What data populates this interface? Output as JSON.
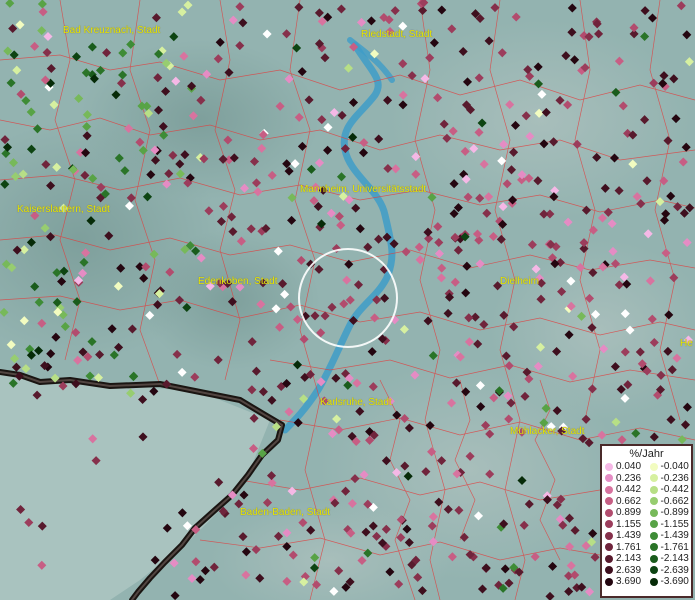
{
  "map": {
    "cities": [
      {
        "id": "bad-kreuznach",
        "label": "Bad Kreuznach, Stadt"
      },
      {
        "id": "riedstadt",
        "label": "Riedstadt, Stadt"
      },
      {
        "id": "mannheim",
        "label": "Mannheim, Universitätsstadt"
      },
      {
        "id": "kaiserslautern",
        "label": "Kaiserslautern, Stadt"
      },
      {
        "id": "edenkoben",
        "label": "Edenkoben, Stadt"
      },
      {
        "id": "dielheim",
        "label": "Dielheim"
      },
      {
        "id": "he-partial",
        "label": "He"
      },
      {
        "id": "karlsruhe",
        "label": "Karlsruhe, Stadt"
      },
      {
        "id": "muehlacker",
        "label": "Mühlacker, Stadt"
      },
      {
        "id": "baden-baden",
        "label": "Baden-Baden, Stadt"
      }
    ]
  },
  "legend": {
    "title": "%/Jahr",
    "positive": [
      {
        "label": "0.040",
        "color": "#f5b8e6"
      },
      {
        "label": "0.236",
        "color": "#e58cc4"
      },
      {
        "label": "0.442",
        "color": "#d8739f"
      },
      {
        "label": "0.662",
        "color": "#c75e84"
      },
      {
        "label": "0.899",
        "color": "#b24c6e"
      },
      {
        "label": "1.155",
        "color": "#9c3d5c"
      },
      {
        "label": "1.439",
        "color": "#86304b"
      },
      {
        "label": "1.761",
        "color": "#70243c"
      },
      {
        "label": "2.143",
        "color": "#581a2d"
      },
      {
        "label": "2.639",
        "color": "#3e0f1e"
      },
      {
        "label": "3.690",
        "color": "#240610"
      }
    ],
    "negative": [
      {
        "label": "-0.040",
        "color": "#f2fcc0"
      },
      {
        "label": "-0.236",
        "color": "#d6f0a0"
      },
      {
        "label": "-0.442",
        "color": "#b7df86"
      },
      {
        "label": "-0.662",
        "color": "#97cd70"
      },
      {
        "label": "-0.899",
        "color": "#77b95a"
      },
      {
        "label": "-1.155",
        "color": "#58a346"
      },
      {
        "label": "-1.439",
        "color": "#3e8c36"
      },
      {
        "label": "-1.761",
        "color": "#2a7428"
      },
      {
        "label": "-2.143",
        "color": "#1a5c1c"
      },
      {
        "label": "-2.639",
        "color": "#0d4412"
      },
      {
        "label": "-3.690",
        "color": "#062b08"
      }
    ]
  }
}
